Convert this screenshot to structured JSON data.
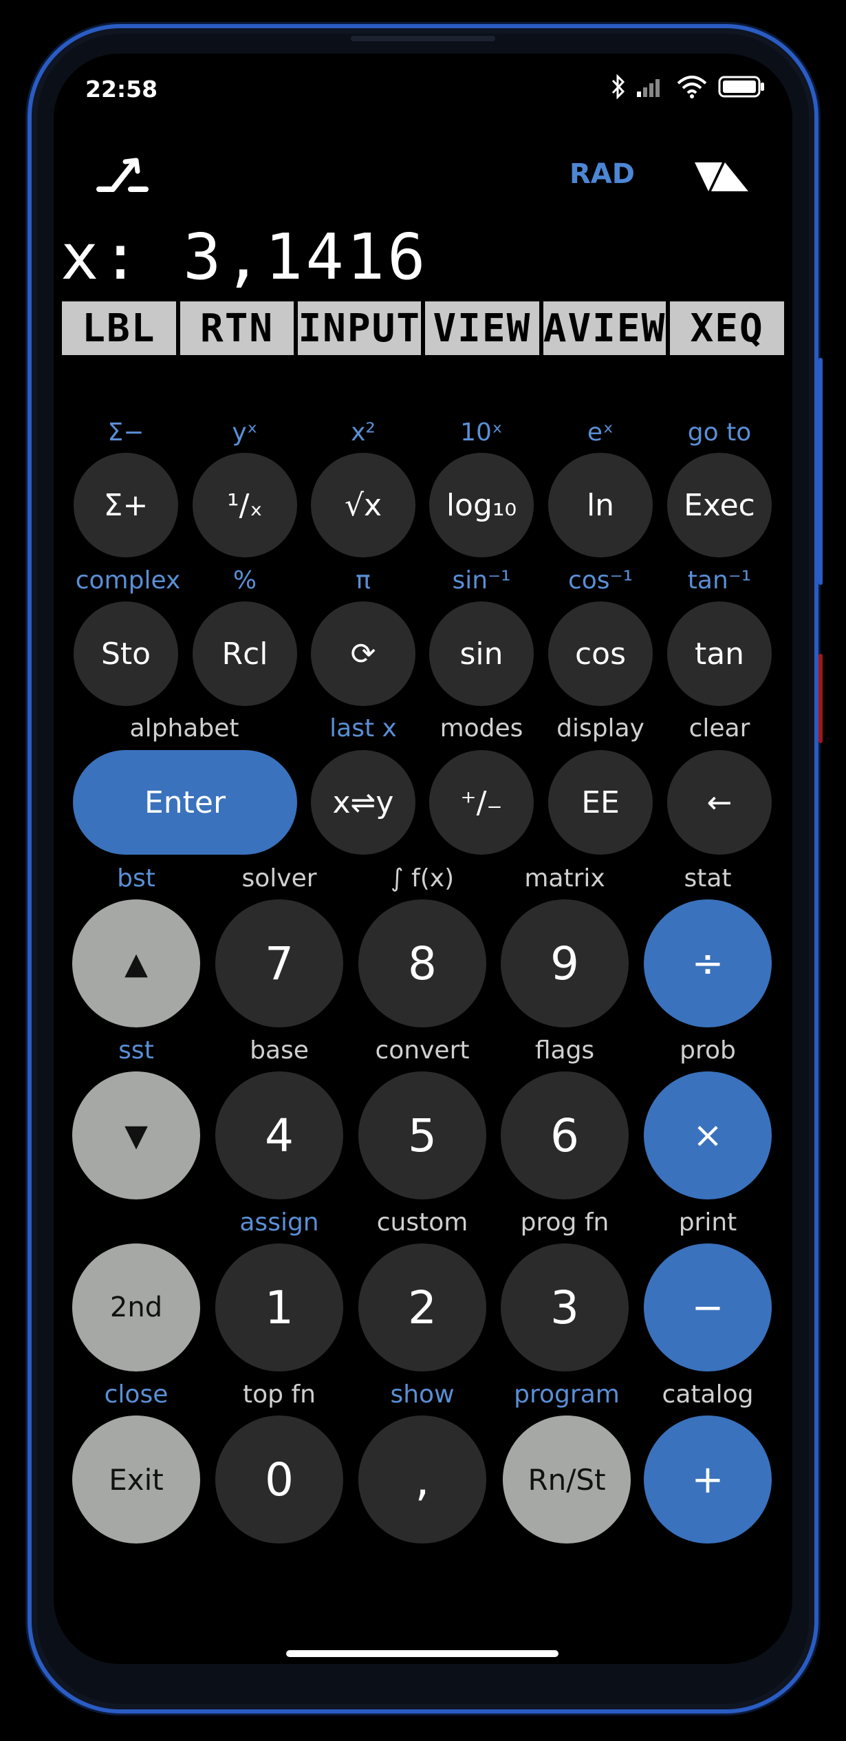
{
  "status": {
    "time": "22:58"
  },
  "header": {
    "angle_mode": "RAD"
  },
  "display": {
    "text": "x: 3,1416"
  },
  "menu": [
    "LBL",
    "RTN",
    "INPUT",
    "VIEW",
    "AVIEW",
    "XEQ"
  ],
  "rows": [
    {
      "keys": [
        {
          "shift": "Σ−",
          "shift_color": "blue",
          "label": "Σ+"
        },
        {
          "shift": "yˣ",
          "shift_color": "blue",
          "label": "¹/ₓ"
        },
        {
          "shift": "x²",
          "shift_color": "blue",
          "label": "√x"
        },
        {
          "shift": "10ˣ",
          "shift_color": "blue",
          "label": "log₁₀"
        },
        {
          "shift": "eˣ",
          "shift_color": "blue",
          "label": "ln"
        },
        {
          "shift": "go to",
          "shift_color": "blue",
          "label": "Exec"
        }
      ]
    },
    {
      "keys": [
        {
          "shift": "complex",
          "shift_color": "blue",
          "label": "Sto"
        },
        {
          "shift": "%",
          "shift_color": "blue",
          "label": "Rcl"
        },
        {
          "shift": "π",
          "shift_color": "blue",
          "label": "⟳"
        },
        {
          "shift": "sin⁻¹",
          "shift_color": "blue",
          "label": "sin"
        },
        {
          "shift": "cos⁻¹",
          "shift_color": "blue",
          "label": "cos"
        },
        {
          "shift": "tan⁻¹",
          "shift_color": "blue",
          "label": "tan"
        }
      ]
    },
    {
      "keys": [
        {
          "shift": "alphabet",
          "shift_color": "white",
          "label": "Enter"
        },
        {
          "shift": "last x",
          "shift_color": "blue",
          "label": "x⇌y"
        },
        {
          "shift": "modes",
          "shift_color": "white",
          "label": "⁺/₋"
        },
        {
          "shift": "display",
          "shift_color": "white",
          "label": "EE"
        },
        {
          "shift": "clear",
          "shift_color": "white",
          "label": "←"
        }
      ]
    },
    {
      "keys": [
        {
          "shift": "bst",
          "shift_color": "blue",
          "label": "▲"
        },
        {
          "shift": "solver",
          "shift_color": "white",
          "label": "7"
        },
        {
          "shift": "∫ f(x)",
          "shift_color": "white",
          "label": "8"
        },
        {
          "shift": "matrix",
          "shift_color": "white",
          "label": "9"
        },
        {
          "shift": "stat",
          "shift_color": "white",
          "label": "÷"
        }
      ]
    },
    {
      "keys": [
        {
          "shift": "sst",
          "shift_color": "blue",
          "label": "▼"
        },
        {
          "shift": "base",
          "shift_color": "white",
          "label": "4"
        },
        {
          "shift": "convert",
          "shift_color": "white",
          "label": "5"
        },
        {
          "shift": "flags",
          "shift_color": "white",
          "label": "6"
        },
        {
          "shift": "prob",
          "shift_color": "white",
          "label": "×"
        }
      ]
    },
    {
      "keys": [
        {
          "shift": "",
          "shift_color": "white",
          "label": "2nd"
        },
        {
          "shift": "assign",
          "shift_color": "blue",
          "label": "1"
        },
        {
          "shift": "custom",
          "shift_color": "white",
          "label": "2"
        },
        {
          "shift": "prog fn",
          "shift_color": "white",
          "label": "3"
        },
        {
          "shift": "print",
          "shift_color": "white",
          "label": "−"
        }
      ]
    },
    {
      "keys": [
        {
          "shift": "close",
          "shift_color": "blue",
          "label": "Exit"
        },
        {
          "shift": "top fn",
          "shift_color": "white",
          "label": "0"
        },
        {
          "shift": "show",
          "shift_color": "blue",
          "label": ","
        },
        {
          "shift": "program",
          "shift_color": "blue",
          "label": "Rn/St"
        },
        {
          "shift": "catalog",
          "shift_color": "white",
          "label": "+"
        }
      ]
    }
  ]
}
